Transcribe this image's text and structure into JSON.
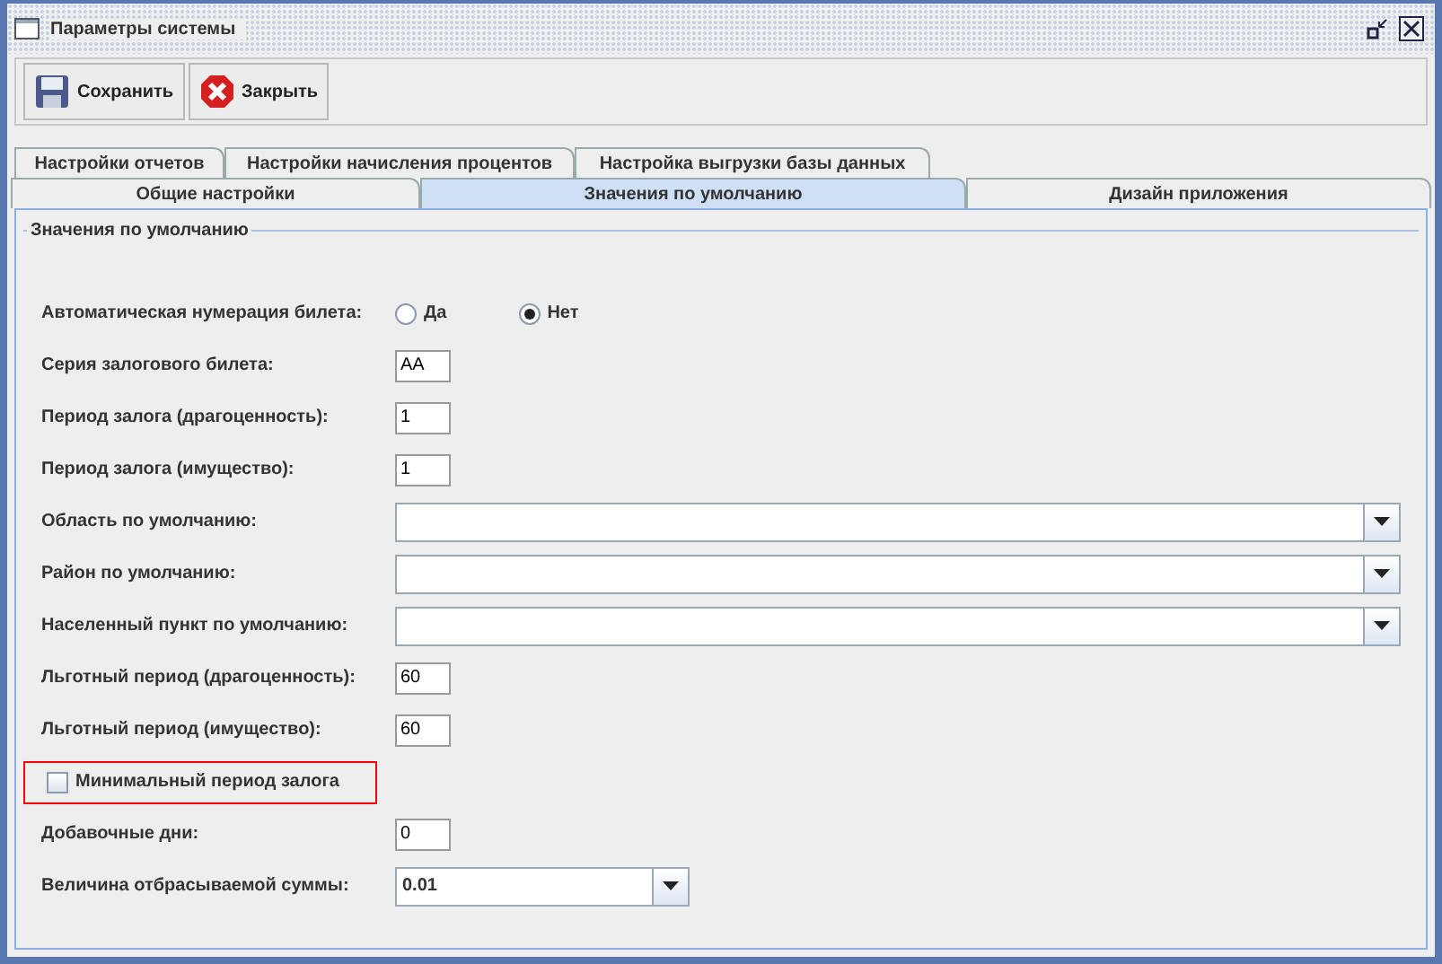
{
  "window": {
    "title": "Параметры системы"
  },
  "toolbar": [
    {
      "label": "Сохранить",
      "kind": "save"
    },
    {
      "label": "Закрыть",
      "kind": "close"
    }
  ],
  "tab_rows": [
    [
      {
        "label": "Настройки отчетов",
        "selected": false
      },
      {
        "label": "Настройки начисления процентов",
        "selected": false
      },
      {
        "label": "Настройка выгрузки базы данных",
        "selected": false
      }
    ],
    [
      {
        "label": "Общие настройки",
        "selected": false
      },
      {
        "label": "Значения по умолчанию",
        "selected": true
      },
      {
        "label": "Дизайн приложения",
        "selected": false
      }
    ]
  ],
  "group_title": "Значения по умолчанию",
  "rows": [
    {
      "kind": "radio",
      "label": "Автоматическая нумерация билета:",
      "options": [
        {
          "label": "Да",
          "selected": false
        },
        {
          "label": "Нет",
          "selected": true
        }
      ]
    },
    {
      "kind": "text",
      "label": "Серия залогового билета:",
      "value": "АА"
    },
    {
      "kind": "text",
      "label": "Период залога (драгоценность):",
      "value": "1"
    },
    {
      "kind": "text",
      "label": "Период залога (имущество):",
      "value": "1"
    },
    {
      "kind": "combo",
      "label": "Область по умолчанию:"
    },
    {
      "kind": "combo",
      "label": "Район по умолчанию:"
    },
    {
      "kind": "combo",
      "label": "Населенный пункт по умолчанию:"
    },
    {
      "kind": "text",
      "label": "Льготный период (драгоценность):",
      "value": "60"
    },
    {
      "kind": "text",
      "label": "Льготный период (имущество):",
      "value": "60"
    },
    {
      "kind": "checkbox",
      "label": "Минимальный период залога",
      "checked": false,
      "highlighted": true
    },
    {
      "kind": "text",
      "label": "Добавочные дни:",
      "value": "0"
    },
    {
      "kind": "select",
      "label": "Величина отбрасываемой суммы:",
      "value": "0.01"
    }
  ]
}
